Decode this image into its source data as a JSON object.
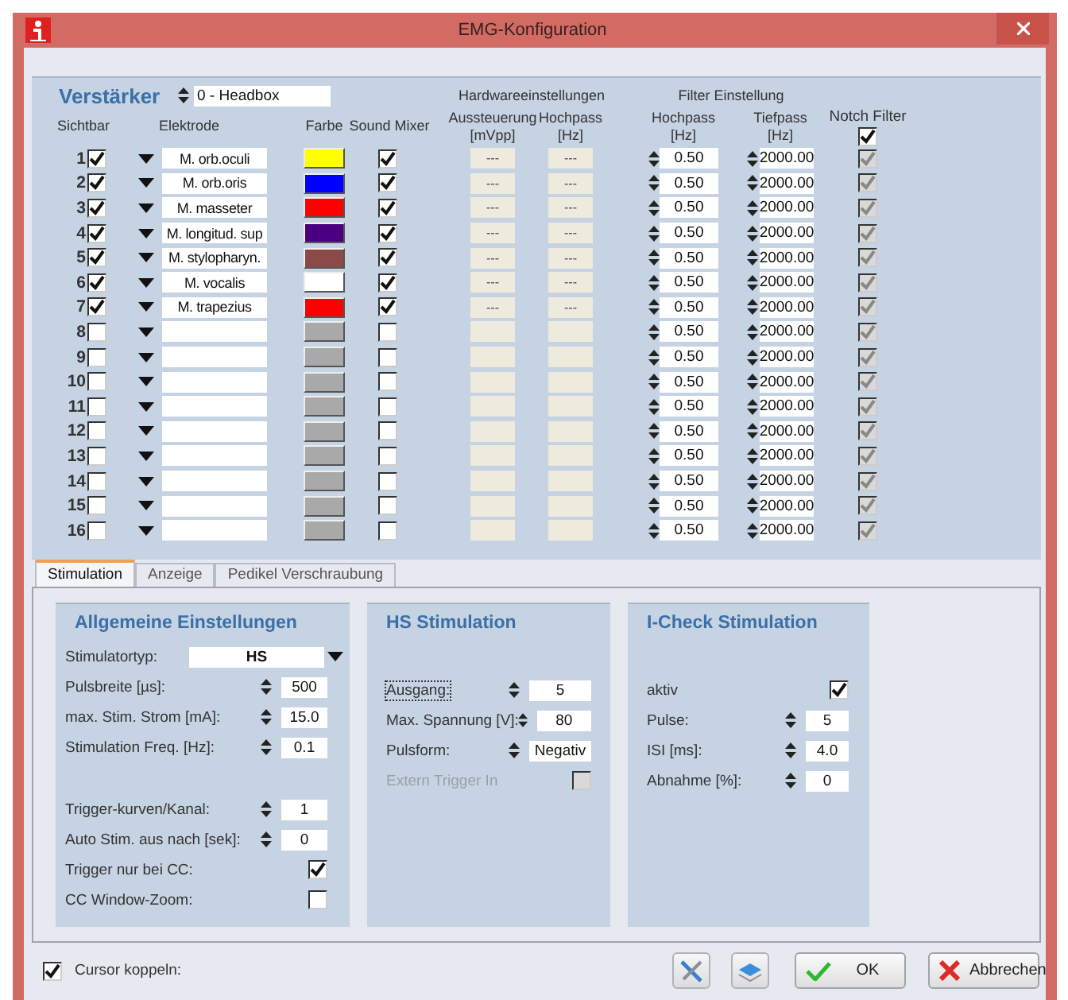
{
  "window": {
    "title": "EMG-Konfiguration"
  },
  "amplifier": {
    "title": "Verstärker",
    "device": "0 - Headbox",
    "group_headers": [
      "Hardwareeinstellungen",
      "Filter Einstellung"
    ],
    "columns": [
      "Sichtbar",
      "Elektrode",
      "Farbe",
      "Sound Mixer",
      "Aussteuerung\n[mVpp]",
      "Hochpass\n[Hz]",
      "Hochpass\n[Hz]",
      "Tiefpass\n[Hz]",
      "Notch Filter"
    ],
    "notch_all": true,
    "channels": [
      {
        "number": "1",
        "visible": true,
        "electrode": "M. orb.oculi",
        "color": "#ffff00",
        "sound": true,
        "gain": "---",
        "hw_highpass": "---",
        "highpass": "0.50",
        "lowpass": "2000.00",
        "notch": true
      },
      {
        "number": "2",
        "visible": true,
        "electrode": "M. orb.oris",
        "color": "#0000ff",
        "sound": true,
        "gain": "---",
        "hw_highpass": "---",
        "highpass": "0.50",
        "lowpass": "2000.00",
        "notch": true
      },
      {
        "number": "3",
        "visible": true,
        "electrode": "M. masseter",
        "color": "#ff0000",
        "sound": true,
        "gain": "---",
        "hw_highpass": "---",
        "highpass": "0.50",
        "lowpass": "2000.00",
        "notch": true
      },
      {
        "number": "4",
        "visible": true,
        "electrode": "M. longitud. sup",
        "color": "#4b0082",
        "sound": true,
        "gain": "---",
        "hw_highpass": "---",
        "highpass": "0.50",
        "lowpass": "2000.00",
        "notch": true
      },
      {
        "number": "5",
        "visible": true,
        "electrode": "M. stylopharyn.",
        "color": "#8b4a48",
        "sound": true,
        "gain": "---",
        "hw_highpass": "---",
        "highpass": "0.50",
        "lowpass": "2000.00",
        "notch": true
      },
      {
        "number": "6",
        "visible": true,
        "electrode": "M. vocalis",
        "color": "#ffffff",
        "sound": true,
        "gain": "---",
        "hw_highpass": "---",
        "highpass": "0.50",
        "lowpass": "2000.00",
        "notch": true
      },
      {
        "number": "7",
        "visible": true,
        "electrode": "M. trapezius",
        "color": "#ff0000",
        "sound": true,
        "gain": "---",
        "hw_highpass": "---",
        "highpass": "0.50",
        "lowpass": "2000.00",
        "notch": true
      },
      {
        "number": "8",
        "visible": false,
        "color": "#a9a9a9",
        "sound": false,
        "highpass": "0.50",
        "lowpass": "2000.00",
        "notch": true
      },
      {
        "number": "9",
        "visible": false,
        "color": "#a9a9a9",
        "sound": false,
        "highpass": "0.50",
        "lowpass": "2000.00",
        "notch": true
      },
      {
        "number": "10",
        "visible": false,
        "color": "#a9a9a9",
        "sound": false,
        "highpass": "0.50",
        "lowpass": "2000.00",
        "notch": true
      },
      {
        "number": "11",
        "visible": false,
        "color": "#a9a9a9",
        "sound": false,
        "highpass": "0.50",
        "lowpass": "2000.00",
        "notch": true
      },
      {
        "number": "12",
        "visible": false,
        "color": "#a9a9a9",
        "sound": false,
        "highpass": "0.50",
        "lowpass": "2000.00",
        "notch": true
      },
      {
        "number": "13",
        "visible": false,
        "color": "#a9a9a9",
        "sound": false,
        "highpass": "0.50",
        "lowpass": "2000.00",
        "notch": true
      },
      {
        "number": "14",
        "visible": false,
        "color": "#a9a9a9",
        "sound": false,
        "highpass": "0.50",
        "lowpass": "2000.00",
        "notch": true
      },
      {
        "number": "15",
        "visible": false,
        "color": "#a9a9a9",
        "sound": false,
        "highpass": "0.50",
        "lowpass": "2000.00",
        "notch": true
      },
      {
        "number": "16",
        "visible": false,
        "color": "#a9a9a9",
        "sound": false,
        "highpass": "0.50",
        "lowpass": "2000.00",
        "notch": true
      }
    ]
  },
  "tabs": [
    {
      "label": "Stimulation",
      "selected": true
    },
    {
      "label": "Anzeige",
      "selected": false
    },
    {
      "label": "Pedikel Verschraubung",
      "selected": false
    }
  ],
  "groups": [
    {
      "title": "Allgemeine Einstellungen",
      "sections": [
        [
          {
            "kind": "select",
            "label": "Stimulatortyp:",
            "value": "HS"
          },
          {
            "kind": "spin",
            "label": "Pulsbreite [µs]:",
            "value": "500"
          },
          {
            "kind": "spin",
            "label": "max. Stim. Strom [mA]:",
            "value": "15.0"
          },
          {
            "kind": "spin",
            "label": "Stimulation Freq. [Hz]:",
            "value": "0.1"
          }
        ],
        [
          {
            "kind": "spin",
            "label": "Trigger-kurven/Kanal:",
            "value": "1"
          },
          {
            "kind": "spin",
            "label": "Auto Stim. aus nach [sek]:",
            "value": "0"
          },
          {
            "kind": "check",
            "label": "Trigger nur bei CC:",
            "checked": true,
            "disabled": false
          },
          {
            "kind": "check",
            "label": "CC  Window-Zoom:",
            "checked": false,
            "disabled": false
          }
        ]
      ]
    },
    {
      "title": "HS Stimulation",
      "sections": [
        [
          {
            "kind": "spin",
            "label": "Ausgang:",
            "value": "5",
            "focused": true
          },
          {
            "kind": "spin",
            "label": "Max. Spannung [V]:",
            "value": "80",
            "focused": false
          },
          {
            "kind": "spin",
            "label": "Pulsform:",
            "value": "Negativ",
            "focused": false
          },
          {
            "kind": "check",
            "label": "Extern Trigger In",
            "checked": false,
            "disabled": true
          }
        ]
      ]
    },
    {
      "title": "I-Check Stimulation",
      "sections": [
        [
          {
            "kind": "check",
            "label": "aktiv",
            "checked": true,
            "disabled": false
          },
          {
            "kind": "spin",
            "label": "Pulse:",
            "value": "5"
          },
          {
            "kind": "spin",
            "label": "ISI [ms]:",
            "value": "4.0"
          },
          {
            "kind": "spin",
            "label": "Abnahme [%]:",
            "value": "0"
          }
        ]
      ]
    }
  ],
  "cursor_link": {
    "label": "Cursor koppeln:",
    "checked": true
  },
  "buttons": [
    {
      "kind": "tools"
    },
    {
      "kind": "sync"
    },
    {
      "kind": "ok",
      "label": "OK"
    },
    {
      "kind": "cancel",
      "label": "Abbrechen"
    }
  ]
}
